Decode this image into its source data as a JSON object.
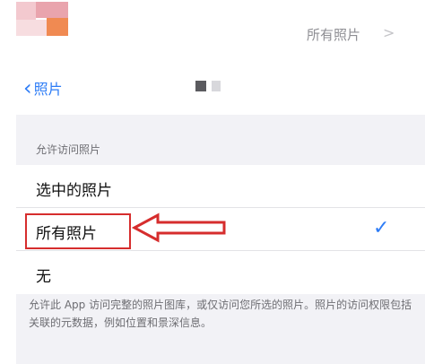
{
  "top_row": {
    "value": "所有照片",
    "chevron_icon": "chevron-right-icon"
  },
  "nav": {
    "back_label": "照片",
    "back_icon": "chevron-left-icon"
  },
  "section": {
    "header": "允许访问照片",
    "options": [
      {
        "label": "选中的照片",
        "selected": false
      },
      {
        "label": "所有照片",
        "selected": true
      },
      {
        "label": "无",
        "selected": false
      }
    ],
    "footer": "允许此 App 访问完整的照片图库，或仅访问您所选的照片。照片的访问权限包括关联的元数据，例如位置和景深信息。"
  },
  "colors": {
    "accent": "#2d7cf6",
    "annotation": "#d62d2d",
    "grouped_background": "#f2f2f6"
  }
}
